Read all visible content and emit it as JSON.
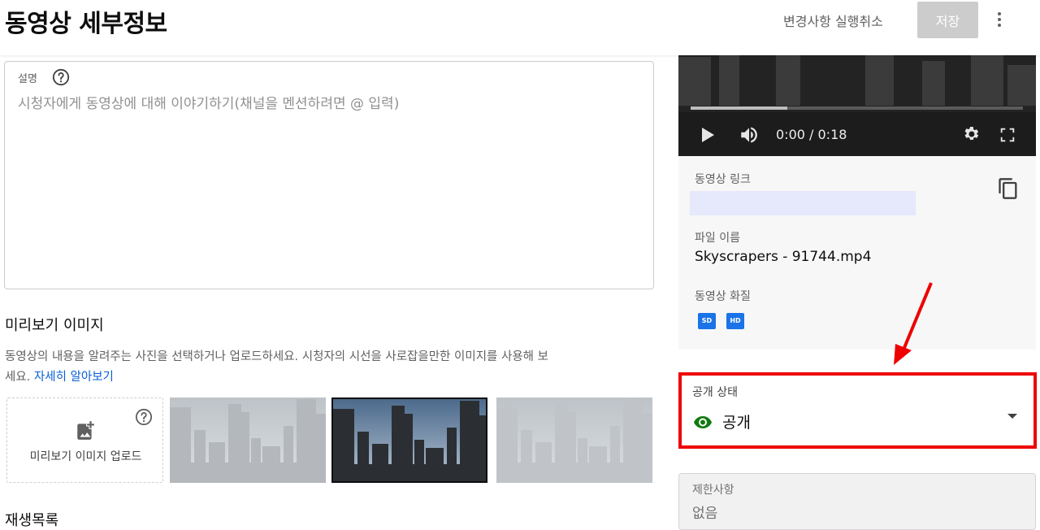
{
  "header": {
    "title": "동영상 세부정보",
    "undo_label": "변경사항 실행취소",
    "save_label": "저장"
  },
  "description": {
    "label": "설명",
    "placeholder": "시청자에게 동영상에 대해 이야기하기(채널을 멘션하려면 @ 입력)"
  },
  "thumbnail": {
    "title": "미리보기 이미지",
    "description_line1": "동영상의 내용을 알려주는 사진을 선택하거나 업로드하세요. 시청자의 시선을 사로잡을만한 이미지를 사용해 보",
    "description_line2": "세요.",
    "learn_more": "자세히 알아보기",
    "upload_label": "미리보기 이미지 업로드",
    "selected_index": 1
  },
  "playlist": {
    "title": "재생목록"
  },
  "player": {
    "time": "0:00 / 0:18",
    "progress": 0.29
  },
  "video_info": {
    "link_label": "동영상 링크",
    "link_value": "",
    "file_label": "파일 이름",
    "file_name": "Skyscrapers - 91744.mp4",
    "quality_label": "동영상 화질",
    "quality_badges": [
      "SD",
      "HD"
    ]
  },
  "visibility": {
    "label": "공개 상태",
    "value": "공개"
  },
  "restrictions": {
    "label": "제한사항",
    "value": "없음"
  },
  "colors": {
    "annotation_red": "#ee0000",
    "link_blue": "#065fd4",
    "eye_green": "#0f7b0f",
    "badge_blue": "#1a73e8"
  }
}
